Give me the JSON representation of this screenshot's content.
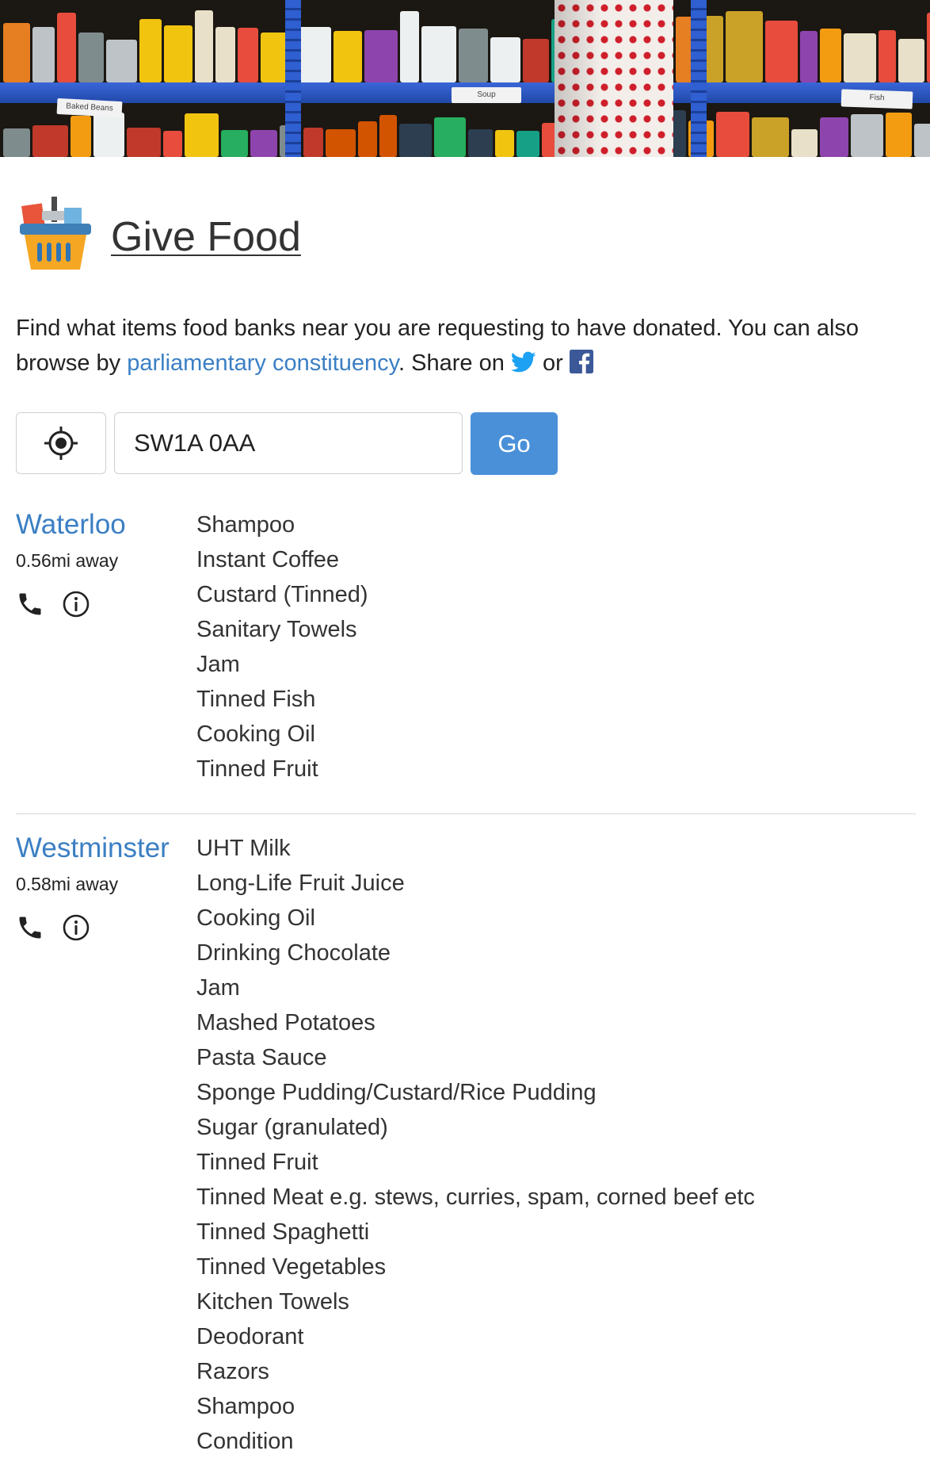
{
  "header": {
    "shelf_tags": [
      "Baked Beans",
      "Soup",
      "Fish"
    ]
  },
  "brand": {
    "title": "Give Food",
    "logo_icon": "shopping-basket-icon"
  },
  "intro": {
    "text_before": "Find what items food banks near you are requesting to have donated. You can also browse by ",
    "link_label": "parliamentary constituency",
    "text_share": ". Share on ",
    "text_or": " or ",
    "twitter_icon": "twitter-icon",
    "facebook_icon": "facebook-icon"
  },
  "search": {
    "locate_icon": "crosshair-locate-icon",
    "postcode_value": "SW1A 0AA",
    "go_label": "Go"
  },
  "colors": {
    "accent": "#4a90d9",
    "link": "#3b7fc4",
    "text": "#222222"
  },
  "foodbanks": [
    {
      "name": "Waterloo",
      "distance": "0.56mi away",
      "icons": [
        "phone-icon",
        "info-icon"
      ],
      "needs": [
        "Shampoo",
        "Instant Coffee",
        "Custard (Tinned)",
        "Sanitary Towels",
        "Jam",
        "Tinned Fish",
        "Cooking Oil",
        "Tinned Fruit"
      ]
    },
    {
      "name": "Westminster",
      "distance": "0.58mi away",
      "icons": [
        "phone-icon",
        "info-icon"
      ],
      "needs": [
        "UHT Milk",
        "Long-Life Fruit Juice",
        "Cooking Oil",
        "Drinking Chocolate",
        "Jam",
        "Mashed Potatoes",
        "Pasta Sauce",
        "Sponge Pudding/Custard/Rice Pudding",
        "Sugar (granulated)",
        "Tinned Fruit",
        "Tinned Meat e.g. stews, curries, spam, corned beef etc",
        "Tinned Spaghetti",
        "Tinned Vegetables",
        "Kitchen Towels",
        "Deodorant",
        "Razors",
        "Shampoo",
        "Condition"
      ]
    }
  ]
}
